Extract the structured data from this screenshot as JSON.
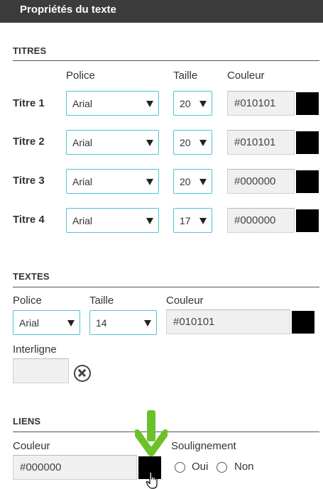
{
  "header": {
    "title": "Propriétés du texte"
  },
  "titres": {
    "section_title": "TITRES",
    "col_police": "Police",
    "col_taille": "Taille",
    "col_couleur": "Couleur",
    "rows": [
      {
        "label": "Titre 1",
        "font": "Arial",
        "size": "20",
        "color": "#010101"
      },
      {
        "label": "Titre 2",
        "font": "Arial",
        "size": "20",
        "color": "#010101"
      },
      {
        "label": "Titre 3",
        "font": "Arial",
        "size": "20",
        "color": "#000000"
      },
      {
        "label": "Titre 4",
        "font": "Arial",
        "size": "17",
        "color": "#000000"
      }
    ]
  },
  "textes": {
    "section_title": "TEXTES",
    "label_police": "Police",
    "label_taille": "Taille",
    "label_couleur": "Couleur",
    "font": "Arial",
    "size": "14",
    "color": "#010101",
    "label_interligne": "Interligne",
    "interligne_value": ""
  },
  "liens": {
    "section_title": "LIENS",
    "label_couleur": "Couleur",
    "color": "#000000",
    "label_soulignement": "Soulignement",
    "option_oui": "Oui",
    "option_non": "Non"
  },
  "colors": {
    "header_bg": "#3c3c3c",
    "select_border": "#4fc3d2",
    "input_bg": "#f0f0f0",
    "swatch": "#000000",
    "annotation_arrow": "#6cc12a"
  }
}
